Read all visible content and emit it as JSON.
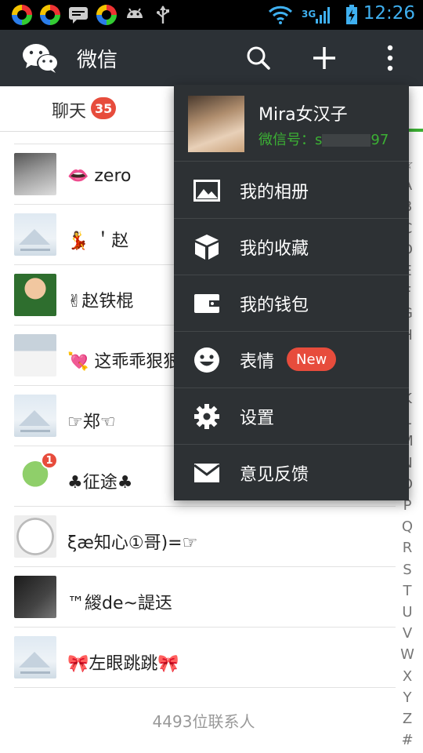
{
  "status_bar": {
    "time": "12:26",
    "network": "3G"
  },
  "header": {
    "title": "微信",
    "icons": [
      "wechat-logo-icon",
      "search-icon",
      "plus-icon",
      "more-vert-icon"
    ]
  },
  "tabs": {
    "chats_label": "聊天",
    "chats_badge": "35"
  },
  "contacts": [
    {
      "name": "👄 zero",
      "avatar": "photo-gray"
    },
    {
      "name": "💃 ＇赵",
      "avatar": "default"
    },
    {
      "name": "✌赵铁棍",
      "avatar": "photo-boy"
    },
    {
      "name": "💘 这乖乖狠狠",
      "avatar": "photo-uniform"
    },
    {
      "name": "☞郑☜",
      "avatar": "default"
    },
    {
      "name": "♣征途♣",
      "avatar": "cartoon",
      "badge": "1"
    },
    {
      "name": "ξæ知心①哥)=☞",
      "avatar": "clock"
    },
    {
      "name": "™緵de~諟迗",
      "avatar": "photo-dark"
    },
    {
      "name": "🎀左眼跳跳🎀",
      "avatar": "default"
    }
  ],
  "contact_count": "4493位联系人",
  "index_letters": [
    "☆",
    "A",
    "B",
    "C",
    "D",
    "E",
    "F",
    "G",
    "H",
    "I",
    "J",
    "K",
    "L",
    "M",
    "N",
    "O",
    "P",
    "Q",
    "R",
    "S",
    "T",
    "U",
    "V",
    "W",
    "X",
    "Y",
    "Z",
    "#"
  ],
  "menu": {
    "profile_name": "Mira女汉子",
    "profile_id_prefix": "微信号：s",
    "profile_id_suffix": "97",
    "items": [
      {
        "label": "我的相册",
        "icon": "image-icon"
      },
      {
        "label": "我的收藏",
        "icon": "cube-icon"
      },
      {
        "label": "我的钱包",
        "icon": "wallet-icon"
      },
      {
        "label": "表情",
        "icon": "smiley-icon",
        "badge": "New"
      },
      {
        "label": "设置",
        "icon": "gear-icon"
      },
      {
        "label": "意见反馈",
        "icon": "mail-icon"
      }
    ]
  },
  "colors": {
    "titlebar": "#2c3136",
    "menu_bg": "#2d3134",
    "accent_green": "#3cb034",
    "badge_red": "#e74c3c",
    "clock_blue": "#3fb0f0"
  }
}
